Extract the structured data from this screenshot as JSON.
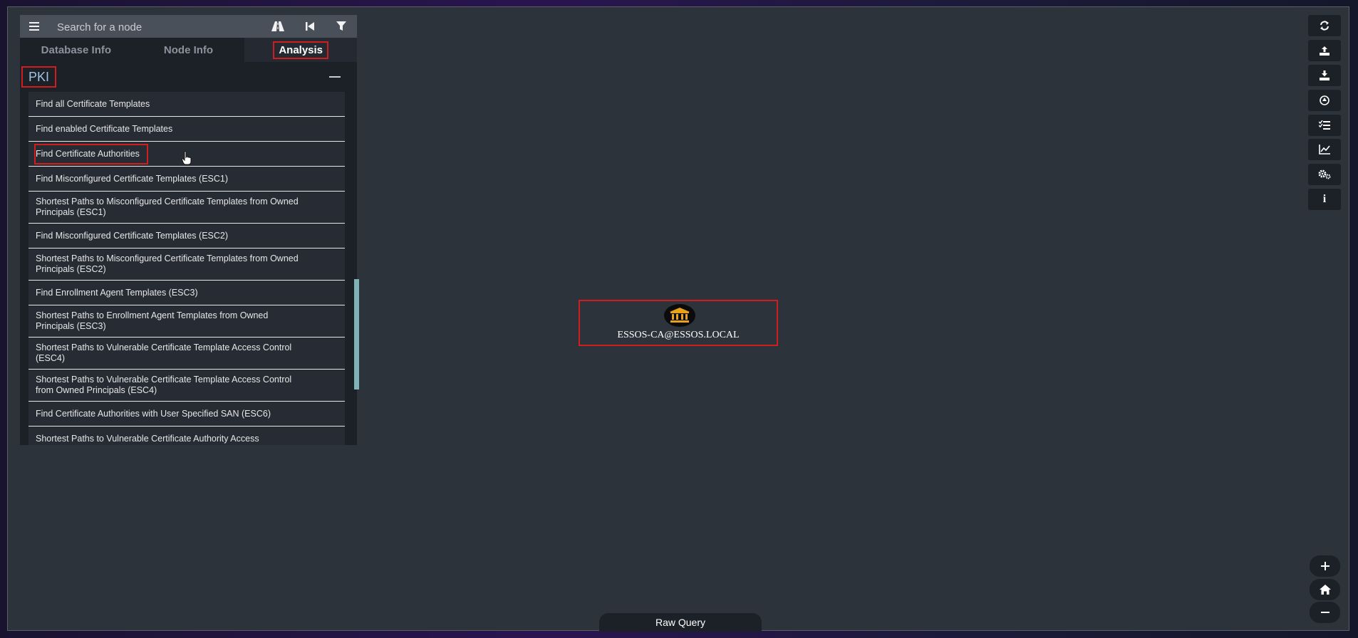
{
  "search": {
    "placeholder": "Search for a node"
  },
  "tabs": [
    {
      "label": "Database Info"
    },
    {
      "label": "Node Info"
    },
    {
      "label": "Analysis"
    }
  ],
  "section": {
    "title": "PKI"
  },
  "queries": [
    {
      "label": "Find all Certificate Templates"
    },
    {
      "label": "Find enabled Certificate Templates"
    },
    {
      "label": "Find Certificate Authorities"
    },
    {
      "label": "Find Misconfigured Certificate Templates (ESC1)"
    },
    {
      "label": "Shortest Paths to Misconfigured Certificate Templates from Owned Principals (ESC1)"
    },
    {
      "label": "Find Misconfigured Certificate Templates (ESC2)"
    },
    {
      "label": "Shortest Paths to Misconfigured Certificate Templates from Owned Principals (ESC2)"
    },
    {
      "label": "Find Enrollment Agent Templates (ESC3)"
    },
    {
      "label": "Shortest Paths to Enrollment Agent Templates from Owned Principals (ESC3)"
    },
    {
      "label": "Shortest Paths to Vulnerable Certificate Template Access Control (ESC4)"
    },
    {
      "label": "Shortest Paths to Vulnerable Certificate Template Access Control from Owned Principals (ESC4)"
    },
    {
      "label": "Find Certificate Authorities with User Specified SAN (ESC6)"
    },
    {
      "label": "Shortest Paths to Vulnerable Certificate Authority Access"
    }
  ],
  "graph": {
    "node": {
      "label": "ESSOS-CA@ESSOS.LOCAL",
      "icon": "bank-icon"
    }
  },
  "raw_query": {
    "label": "Raw Query"
  },
  "toolbar": {
    "icons": [
      "refresh-icon",
      "upload-icon",
      "download-icon",
      "eye-icon",
      "list-icon",
      "chart-icon",
      "settings-icon",
      "info-icon"
    ],
    "info_label": "i"
  },
  "zoom": {
    "icons": [
      "zoom-in-icon",
      "home-icon",
      "zoom-out-icon"
    ]
  },
  "colors": {
    "highlight": "#d01e1e",
    "background": "#2d333b",
    "panel": "#1c2027"
  }
}
